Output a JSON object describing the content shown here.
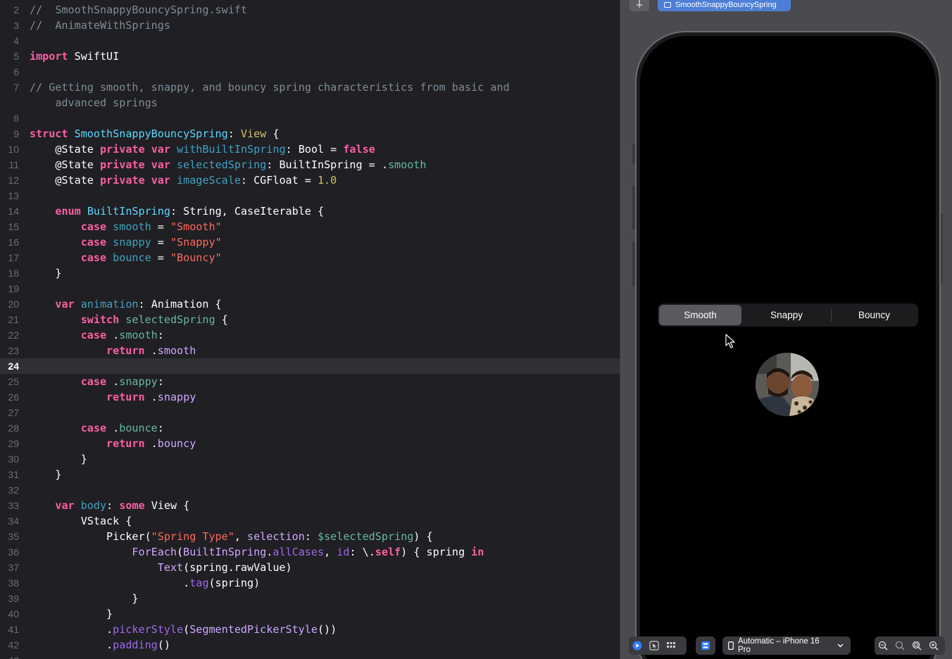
{
  "editor": {
    "current_line": "24",
    "lines": [
      {
        "n": "2",
        "tokens": [
          [
            "comment",
            "//  SmoothSnappyBouncySpring.swift"
          ]
        ]
      },
      {
        "n": "3",
        "tokens": [
          [
            "comment",
            "//  AnimateWithSprings"
          ]
        ]
      },
      {
        "n": "4",
        "tokens": []
      },
      {
        "n": "5",
        "tokens": [
          [
            "keyword",
            "import"
          ],
          [
            "plain",
            " SwiftUI"
          ]
        ]
      },
      {
        "n": "6",
        "tokens": []
      },
      {
        "n": "7",
        "tokens": [
          [
            "comment",
            "// Getting smooth, snappy, and bouncy spring characteristics from basic and"
          ]
        ]
      },
      {
        "n": "",
        "tokens": [
          [
            "comment",
            "    advanced springs"
          ]
        ]
      },
      {
        "n": "8",
        "tokens": []
      },
      {
        "n": "9",
        "tokens": [
          [
            "keyword",
            "struct"
          ],
          [
            "plain",
            " "
          ],
          [
            "typedecl",
            "SmoothSnappyBouncySpring"
          ],
          [
            "plain",
            ": "
          ],
          [
            "type",
            "View"
          ],
          [
            "plain",
            " {"
          ]
        ]
      },
      {
        "n": "10",
        "tokens": [
          [
            "plain",
            "    @State "
          ],
          [
            "keyword",
            "private"
          ],
          [
            "plain",
            " "
          ],
          [
            "keyword",
            "var"
          ],
          [
            "plain",
            " "
          ],
          [
            "declvar",
            "withBuiltInSpring"
          ],
          [
            "plain",
            ": Bool = "
          ],
          [
            "keyword",
            "false"
          ]
        ]
      },
      {
        "n": "11",
        "tokens": [
          [
            "plain",
            "    @State "
          ],
          [
            "keyword",
            "private"
          ],
          [
            "plain",
            " "
          ],
          [
            "keyword",
            "var"
          ],
          [
            "plain",
            " "
          ],
          [
            "declvar",
            "selectedSpring"
          ],
          [
            "plain",
            ": BuiltInSpring = ."
          ],
          [
            "ident",
            "smooth"
          ]
        ]
      },
      {
        "n": "12",
        "tokens": [
          [
            "plain",
            "    @State "
          ],
          [
            "keyword",
            "private"
          ],
          [
            "plain",
            " "
          ],
          [
            "keyword",
            "var"
          ],
          [
            "plain",
            " "
          ],
          [
            "declvar",
            "imageScale"
          ],
          [
            "plain",
            ": CGFloat = "
          ],
          [
            "number",
            "1.0"
          ]
        ]
      },
      {
        "n": "13",
        "tokens": []
      },
      {
        "n": "14",
        "tokens": [
          [
            "plain",
            "    "
          ],
          [
            "keyword",
            "enum"
          ],
          [
            "plain",
            " "
          ],
          [
            "typedecl",
            "BuiltInSpring"
          ],
          [
            "plain",
            ": String, CaseIterable {"
          ]
        ]
      },
      {
        "n": "15",
        "tokens": [
          [
            "plain",
            "        "
          ],
          [
            "keyword",
            "case"
          ],
          [
            "plain",
            " "
          ],
          [
            "declvar",
            "smooth"
          ],
          [
            "plain",
            " = "
          ],
          [
            "string",
            "\"Smooth\""
          ]
        ]
      },
      {
        "n": "16",
        "tokens": [
          [
            "plain",
            "        "
          ],
          [
            "keyword",
            "case"
          ],
          [
            "plain",
            " "
          ],
          [
            "declvar",
            "snappy"
          ],
          [
            "plain",
            " = "
          ],
          [
            "string",
            "\"Snappy\""
          ]
        ]
      },
      {
        "n": "17",
        "tokens": [
          [
            "plain",
            "        "
          ],
          [
            "keyword",
            "case"
          ],
          [
            "plain",
            " "
          ],
          [
            "declvar",
            "bounce"
          ],
          [
            "plain",
            " = "
          ],
          [
            "string",
            "\"Bouncy\""
          ]
        ]
      },
      {
        "n": "18",
        "tokens": [
          [
            "plain",
            "    }"
          ]
        ]
      },
      {
        "n": "19",
        "tokens": []
      },
      {
        "n": "20",
        "tokens": [
          [
            "plain",
            "    "
          ],
          [
            "keyword",
            "var"
          ],
          [
            "plain",
            " "
          ],
          [
            "declvar",
            "animation"
          ],
          [
            "plain",
            ": Animation {"
          ]
        ]
      },
      {
        "n": "21",
        "tokens": [
          [
            "plain",
            "        "
          ],
          [
            "keyword",
            "switch"
          ],
          [
            "plain",
            " "
          ],
          [
            "ident",
            "selectedSpring"
          ],
          [
            "plain",
            " {"
          ]
        ]
      },
      {
        "n": "22",
        "tokens": [
          [
            "plain",
            "        "
          ],
          [
            "keyword",
            "case"
          ],
          [
            "plain",
            " ."
          ],
          [
            "ident",
            "smooth"
          ],
          [
            "plain",
            ":"
          ]
        ]
      },
      {
        "n": "23",
        "tokens": [
          [
            "plain",
            "            "
          ],
          [
            "keyword",
            "return"
          ],
          [
            "plain",
            " ."
          ],
          [
            "other",
            "smooth"
          ]
        ]
      },
      {
        "n": "24",
        "tokens": []
      },
      {
        "n": "25",
        "tokens": [
          [
            "plain",
            "        "
          ],
          [
            "keyword",
            "case"
          ],
          [
            "plain",
            " ."
          ],
          [
            "ident",
            "snappy"
          ],
          [
            "plain",
            ":"
          ]
        ]
      },
      {
        "n": "26",
        "tokens": [
          [
            "plain",
            "            "
          ],
          [
            "keyword",
            "return"
          ],
          [
            "plain",
            " ."
          ],
          [
            "other",
            "snappy"
          ]
        ]
      },
      {
        "n": "27",
        "tokens": []
      },
      {
        "n": "28",
        "tokens": [
          [
            "plain",
            "        "
          ],
          [
            "keyword",
            "case"
          ],
          [
            "plain",
            " ."
          ],
          [
            "ident",
            "bounce"
          ],
          [
            "plain",
            ":"
          ]
        ]
      },
      {
        "n": "29",
        "tokens": [
          [
            "plain",
            "            "
          ],
          [
            "keyword",
            "return"
          ],
          [
            "plain",
            " ."
          ],
          [
            "other",
            "bouncy"
          ]
        ]
      },
      {
        "n": "30",
        "tokens": [
          [
            "plain",
            "        }"
          ]
        ]
      },
      {
        "n": "31",
        "tokens": [
          [
            "plain",
            "    }"
          ]
        ]
      },
      {
        "n": "32",
        "tokens": []
      },
      {
        "n": "33",
        "tokens": [
          [
            "plain",
            "    "
          ],
          [
            "keyword",
            "var"
          ],
          [
            "plain",
            " "
          ],
          [
            "declvar",
            "body"
          ],
          [
            "plain",
            ": "
          ],
          [
            "keyword",
            "some"
          ],
          [
            "plain",
            " View {"
          ]
        ]
      },
      {
        "n": "34",
        "tokens": [
          [
            "plain",
            "        VStack {"
          ]
        ]
      },
      {
        "n": "35",
        "tokens": [
          [
            "plain",
            "            Picker("
          ],
          [
            "string",
            "\"Spring Type\""
          ],
          [
            "plain",
            ", "
          ],
          [
            "other",
            "selection"
          ],
          [
            "plain",
            ": "
          ],
          [
            "ident",
            "$selectedSpring"
          ],
          [
            "plain",
            ") {"
          ]
        ]
      },
      {
        "n": "36",
        "tokens": [
          [
            "plain",
            "                "
          ],
          [
            "systype",
            "ForEach"
          ],
          [
            "plain",
            "("
          ],
          [
            "systype",
            "BuiltInSpring"
          ],
          [
            "plain",
            "."
          ],
          [
            "member",
            "allCases"
          ],
          [
            "plain",
            ", "
          ],
          [
            "member",
            "id"
          ],
          [
            "plain",
            ": \\."
          ],
          [
            "keyword",
            "self"
          ],
          [
            "plain",
            ") { spring "
          ],
          [
            "keyword",
            "in"
          ]
        ]
      },
      {
        "n": "37",
        "tokens": [
          [
            "plain",
            "                    "
          ],
          [
            "systype",
            "Text"
          ],
          [
            "plain",
            "(spring.rawValue)"
          ]
        ]
      },
      {
        "n": "38",
        "tokens": [
          [
            "plain",
            "                        ."
          ],
          [
            "func",
            "tag"
          ],
          [
            "plain",
            "(spring)"
          ]
        ]
      },
      {
        "n": "39",
        "tokens": [
          [
            "plain",
            "                }"
          ]
        ]
      },
      {
        "n": "40",
        "tokens": [
          [
            "plain",
            "            }"
          ]
        ]
      },
      {
        "n": "41",
        "tokens": [
          [
            "plain",
            "            ."
          ],
          [
            "func",
            "pickerStyle"
          ],
          [
            "plain",
            "("
          ],
          [
            "systype",
            "SegmentedPickerStyle"
          ],
          [
            "plain",
            "())"
          ]
        ]
      },
      {
        "n": "42",
        "tokens": [
          [
            "plain",
            "            ."
          ],
          [
            "func",
            "padding"
          ],
          [
            "plain",
            "()"
          ]
        ]
      },
      {
        "n": "43",
        "tokens": []
      }
    ]
  },
  "canvas": {
    "pin_icon": "pin-icon",
    "preview_tab_label": "SmoothSnappyBouncySpring",
    "picker": {
      "segments": [
        "Smooth",
        "Snappy",
        "Bouncy"
      ],
      "selected": "Smooth"
    },
    "avatar_icon": "photo-avatar",
    "toolbar": {
      "live_icon": "play-circle-icon",
      "selectable_icon": "cursor-select-icon",
      "variants_icon": "grid-icon",
      "settings_icon": "device-settings-icon",
      "device_label": "Automatic – iPhone 16 Pro",
      "zoom_icons": [
        "zoom-out-icon",
        "zoom-actual-icon",
        "zoom-fit-icon",
        "zoom-in-icon"
      ]
    }
  },
  "colors": {
    "editor_bg": "#1f1f24",
    "keyword": "#fc5fa3",
    "string": "#fc6a5d",
    "comment": "#7f8c98",
    "accent_tab": "#4d7fd6",
    "canvas_bg": "#4a4b4e"
  }
}
